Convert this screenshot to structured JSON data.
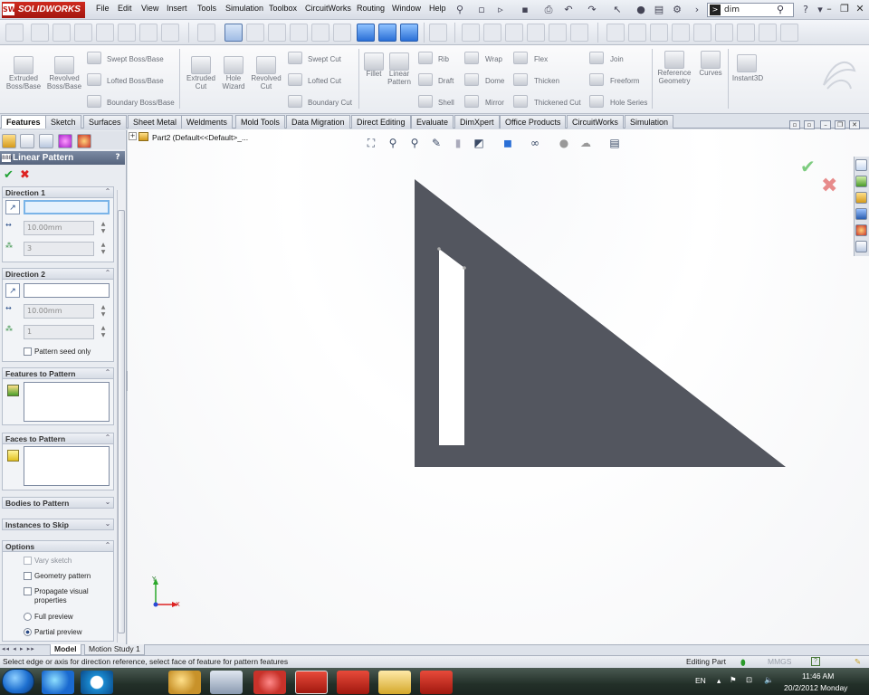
{
  "app": {
    "logo": "SOLIDWORKS",
    "logo_badge": "SW"
  },
  "menu": [
    "File",
    "Edit",
    "View",
    "Insert",
    "Tools",
    "Simulation",
    "Toolbox",
    "CircuitWorks",
    "Routing",
    "Window",
    "Help"
  ],
  "search": {
    "value": "dim",
    "prefix": ">"
  },
  "command_manager": {
    "extruded_boss": "Extruded\nBoss/Base",
    "revolved_boss": "Revolved\nBoss/Base",
    "swept_boss": "Swept Boss/Base",
    "lofted_boss": "Lofted Boss/Base",
    "boundary_boss": "Boundary Boss/Base",
    "extruded_cut": "Extruded\nCut",
    "hole_wizard": "Hole\nWizard",
    "revolved_cut": "Revolved\nCut",
    "swept_cut": "Swept Cut",
    "lofted_cut": "Lofted Cut",
    "boundary_cut": "Boundary Cut",
    "fillet": "Fillet",
    "linear_pattern": "Linear\nPattern",
    "rib": "Rib",
    "draft": "Draft",
    "shell": "Shell",
    "wrap": "Wrap",
    "dome": "Dome",
    "mirror": "Mirror",
    "flex": "Flex",
    "thicken": "Thicken",
    "thickened_cut": "Thickened Cut",
    "join": "Join",
    "freeform": "Freeform",
    "hole_series": "Hole Series",
    "reference_geometry": "Reference\nGeometry",
    "curves": "Curves",
    "instant3d": "Instant3D"
  },
  "tabs": [
    "Features",
    "Sketch",
    "Surfaces",
    "Sheet Metal",
    "Weldments",
    "Mold Tools",
    "Data Migration",
    "Direct Editing",
    "Evaluate",
    "DimXpert",
    "Office Products",
    "CircuitWorks",
    "Simulation"
  ],
  "pm": {
    "title": "Linear Pattern",
    "help": "?",
    "ok": "✔",
    "cancel": "✖",
    "direction1": {
      "title": "Direction 1",
      "spacing": "10.00mm",
      "instances": "3"
    },
    "direction2": {
      "title": "Direction 2",
      "spacing": "10.00mm",
      "instances": "1",
      "seed_only": "Pattern seed only"
    },
    "features_to_pattern": "Features to Pattern",
    "faces_to_pattern": "Faces to Pattern",
    "bodies_to_pattern": "Bodies to Pattern",
    "instances_to_skip": "Instances to Skip",
    "options": {
      "title": "Options",
      "vary_sketch": "Vary sketch",
      "geometry_pattern": "Geometry pattern",
      "propagate": "Propagate visual\nproperties",
      "full_preview": "Full preview",
      "partial_preview": "Partial preview"
    }
  },
  "tree": {
    "node": "Part2  (Default<<Default>_..."
  },
  "axes": {
    "y": "Y",
    "x": "X"
  },
  "model_tabs": [
    "Model",
    "Motion Study 1"
  ],
  "status": {
    "message": "Select edge or axis for direction reference, select face of feature for pattern features",
    "mode": "Editing Part",
    "units": "MMGS",
    "help": "?"
  },
  "tray": {
    "lang": "EN",
    "time": "11:46 AM",
    "date": "20/2/2012 Monday"
  },
  "colors": {
    "part": "#53565f",
    "accent": "#c0201a"
  }
}
